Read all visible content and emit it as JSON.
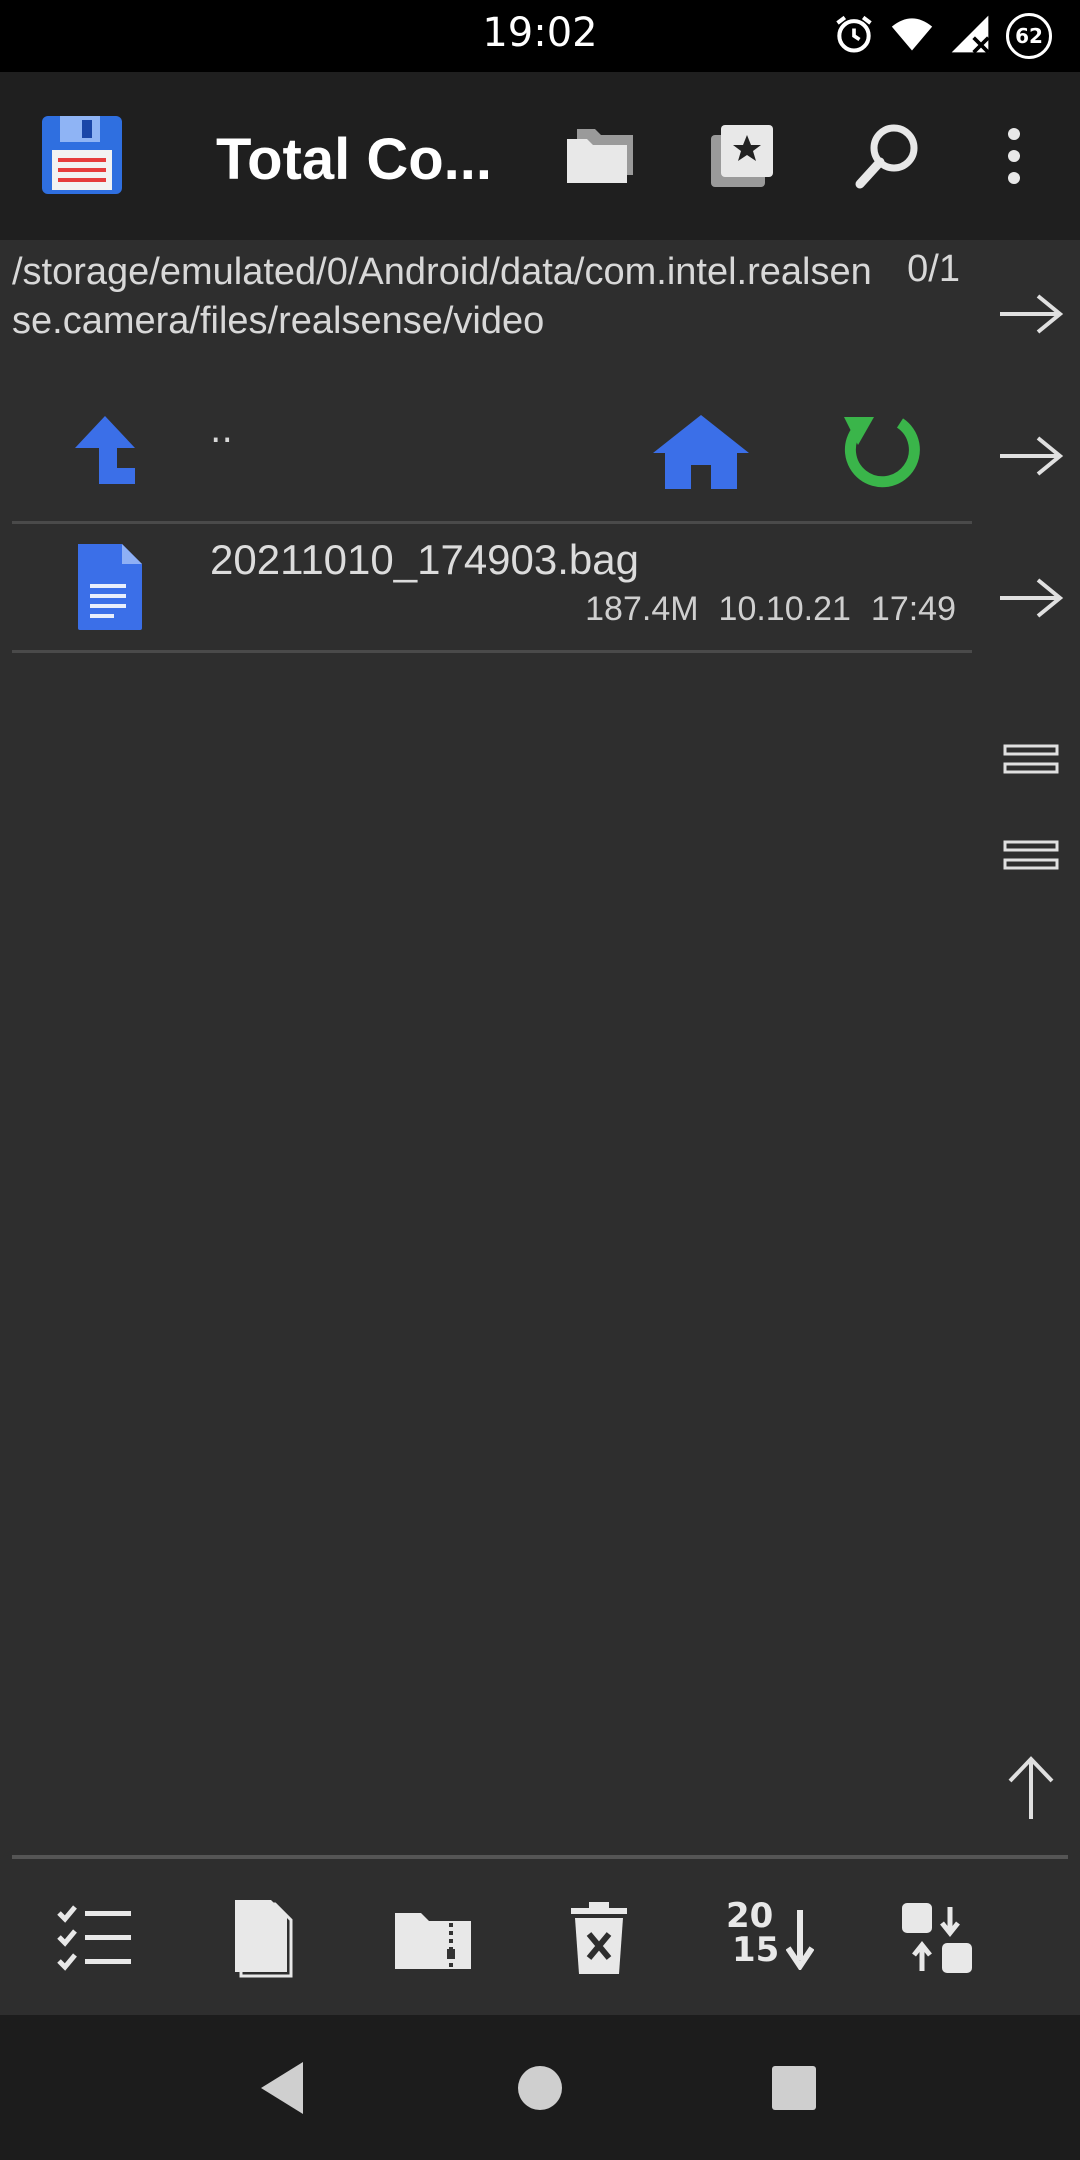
{
  "status_bar": {
    "time": "19:02",
    "battery_level": "62",
    "icons": [
      "alarm-icon",
      "wifi-icon",
      "signal-icon",
      "battery-icon"
    ]
  },
  "app_bar": {
    "title": "Total Co...",
    "actions": [
      "folders-icon",
      "bookmark-icon",
      "search-icon",
      "more-icon"
    ]
  },
  "path": {
    "text": "/storage/emulated/0/Android/data/com.intel.realsense.camera/files/realsense/video",
    "selection_count": "0/1"
  },
  "nav_row": {
    "parent_label": ".."
  },
  "files": [
    {
      "name": "20211010_174903.bag",
      "size": "187.4M",
      "date": "10.10.21",
      "time": "17:49"
    }
  ],
  "bottom_toolbar": {
    "tools": [
      "select-icon",
      "copy-icon",
      "zip-icon",
      "delete-icon",
      "sort-icon",
      "swap-panels-icon"
    ],
    "sort_label_top": "20",
    "sort_label_bottom": "15"
  },
  "colors": {
    "background": "#2e2e2e",
    "appbar": "#1f1f1f",
    "accent_blue": "#3b6fe8",
    "accent_green": "#3ab54a"
  }
}
